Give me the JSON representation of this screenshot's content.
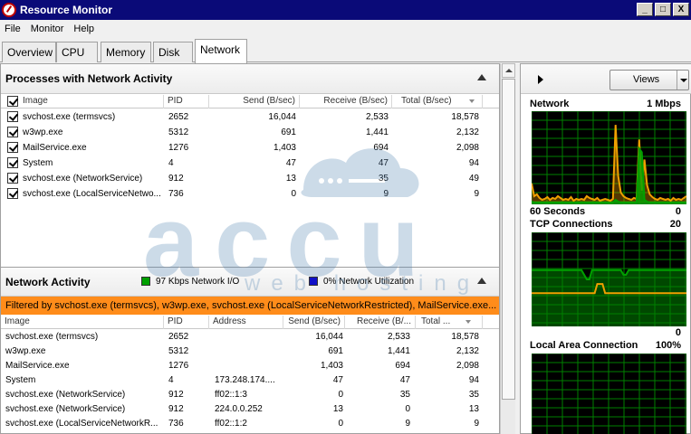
{
  "window": {
    "title": "Resource Monitor",
    "controls": [
      "_",
      "□",
      "X"
    ]
  },
  "menu": [
    "File",
    "Monitor",
    "Help"
  ],
  "tabs": [
    {
      "label": "Overview"
    },
    {
      "label": "CPU"
    },
    {
      "label": "Memory"
    },
    {
      "label": "Disk"
    },
    {
      "label": "Network",
      "active": true
    }
  ],
  "processes": {
    "title": "Processes with Network Activity",
    "columns": [
      "Image",
      "PID",
      "Send (B/sec)",
      "Receive (B/sec)",
      "Total (B/sec)"
    ],
    "rows": [
      {
        "image": "svchost.exe (termsvcs)",
        "pid": "2652",
        "send": "16,044",
        "receive": "2,533",
        "total": "18,578"
      },
      {
        "image": "w3wp.exe",
        "pid": "5312",
        "send": "691",
        "receive": "1,441",
        "total": "2,132"
      },
      {
        "image": "MailService.exe",
        "pid": "1276",
        "send": "1,403",
        "receive": "694",
        "total": "2,098"
      },
      {
        "image": "System",
        "pid": "4",
        "send": "47",
        "receive": "47",
        "total": "94"
      },
      {
        "image": "svchost.exe (NetworkService)",
        "pid": "912",
        "send": "13",
        "receive": "35",
        "total": "49"
      },
      {
        "image": "svchost.exe (LocalServiceNetwo...",
        "pid": "736",
        "send": "0",
        "receive": "9",
        "total": "9"
      }
    ]
  },
  "network_activity": {
    "title": "Network Activity",
    "io_label": "97 Kbps Network I/O",
    "io_color": "#00a000",
    "util_label": "0% Network Utilization",
    "util_color": "#1010c8",
    "filter_text": "Filtered by svchost.exe (termsvcs), w3wp.exe, svchost.exe (LocalServiceNetworkRestricted), MailService.exe...",
    "filter_color": "#ff8c1a",
    "columns": [
      "Image",
      "PID",
      "Address",
      "Send (B/sec)",
      "Receive (B/...",
      "Total ..."
    ],
    "rows": [
      {
        "image": "svchost.exe (termsvcs)",
        "pid": "2652",
        "address": "",
        "send": "16,044",
        "receive": "2,533",
        "total": "18,578"
      },
      {
        "image": "w3wp.exe",
        "pid": "5312",
        "address": "",
        "send": "691",
        "receive": "1,441",
        "total": "2,132"
      },
      {
        "image": "MailService.exe",
        "pid": "1276",
        "address": "",
        "send": "1,403",
        "receive": "694",
        "total": "2,098"
      },
      {
        "image": "System",
        "pid": "4",
        "address": "173.248.174....",
        "send": "47",
        "receive": "47",
        "total": "94"
      },
      {
        "image": "svchost.exe (NetworkService)",
        "pid": "912",
        "address": "ff02::1:3",
        "send": "0",
        "receive": "35",
        "total": "35"
      },
      {
        "image": "svchost.exe (NetworkService)",
        "pid": "912",
        "address": "224.0.0.252",
        "send": "13",
        "receive": "0",
        "total": "13"
      },
      {
        "image": "svchost.exe (LocalServiceNetworkR...",
        "pid": "736",
        "address": "ff02::1:2",
        "send": "0",
        "receive": "9",
        "total": "9"
      }
    ]
  },
  "right_panel": {
    "views_label": "Views",
    "graphs": {
      "network": {
        "title": "Network",
        "max_label": "1 Mbps",
        "time_label": "60 Seconds",
        "min_label": "0"
      },
      "tcp": {
        "title": "TCP Connections",
        "max_label": "20",
        "min_label": "0"
      },
      "lan": {
        "title": "Local Area Connection",
        "max_label": "100%"
      }
    }
  },
  "watermark": {
    "text": "accu",
    "subtext": "web hosting"
  },
  "chart_data": [
    {
      "type": "area",
      "title": "Network",
      "ylim": [
        0,
        100
      ],
      "series": [
        {
          "color": "#f0a000",
          "values": [
            22,
            8,
            10,
            6,
            4,
            5,
            7,
            4,
            6,
            5,
            8,
            6,
            4,
            5,
            4,
            7,
            3,
            5,
            4,
            5,
            4,
            8,
            6,
            5,
            4,
            6,
            3,
            4,
            5,
            4,
            3,
            5,
            86,
            30,
            12,
            8,
            6,
            5,
            4,
            6,
            5,
            70,
            14,
            48,
            20,
            10,
            7,
            5,
            4,
            6,
            5,
            4,
            5,
            3,
            6,
            4,
            5,
            4,
            6,
            8
          ]
        },
        {
          "color": "#00a000",
          "values": [
            2,
            1,
            1,
            1,
            1,
            1,
            1,
            1,
            1,
            1,
            1,
            1,
            1,
            1,
            1,
            1,
            1,
            1,
            1,
            1,
            1,
            1,
            1,
            1,
            1,
            1,
            1,
            1,
            1,
            1,
            1,
            1,
            4,
            2,
            1,
            1,
            1,
            1,
            1,
            1,
            1,
            60,
            56,
            4,
            2,
            1,
            1,
            1,
            1,
            1,
            1,
            1,
            1,
            1,
            1,
            1,
            1,
            1,
            1,
            1
          ]
        }
      ]
    },
    {
      "type": "line",
      "title": "TCP Connections",
      "ylim": [
        0,
        20
      ],
      "series": [
        {
          "color": "#00a000",
          "values": [
            12,
            12,
            12,
            12,
            12,
            12,
            12,
            12,
            12,
            12,
            12,
            12,
            12,
            12,
            12,
            12,
            12,
            12,
            12,
            12,
            11,
            10,
            10,
            12,
            12,
            12,
            12,
            12,
            12,
            12,
            12,
            12,
            12,
            12,
            12,
            11,
            11,
            12,
            12,
            12,
            12,
            12,
            12,
            12,
            12,
            12,
            12,
            12,
            12,
            12,
            12,
            12,
            12,
            12,
            12,
            12,
            12,
            12,
            12,
            12
          ]
        },
        {
          "color": "#f0a000",
          "values": [
            7,
            7,
            7,
            7,
            7,
            7,
            7,
            7,
            7,
            7,
            7,
            7,
            7,
            7,
            7,
            7,
            7,
            7,
            7,
            7,
            7,
            7,
            7,
            7,
            7,
            9,
            9,
            9,
            7,
            7,
            7,
            7,
            7,
            7,
            7,
            7,
            7,
            7,
            7,
            7,
            7,
            7,
            7,
            7,
            7,
            7,
            7,
            7,
            7,
            7,
            7,
            7,
            7,
            7,
            7,
            7,
            7,
            7,
            7,
            7
          ]
        }
      ]
    },
    {
      "type": "line",
      "title": "Local Area Connection",
      "ylim": [
        0,
        100
      ],
      "series": []
    }
  ]
}
